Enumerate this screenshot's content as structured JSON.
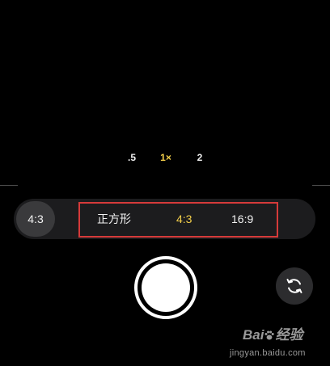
{
  "zoom": {
    "options": [
      ".5",
      "1×",
      "2"
    ],
    "selected": "1×"
  },
  "aspect": {
    "current_label": "4:3",
    "options": [
      "正方形",
      "4:3",
      "16:9"
    ],
    "selected": "4:3"
  },
  "watermark": {
    "brand_left": "Bai",
    "brand_right": "经验",
    "url": "jingyan.baidu.com"
  },
  "colors": {
    "accent": "#f5d04a",
    "highlight_border": "#d63a3a",
    "bar_background": "#1c1c1e"
  },
  "icons": {
    "flip_camera": "rotate-camera-icon",
    "shutter": "shutter-icon"
  }
}
